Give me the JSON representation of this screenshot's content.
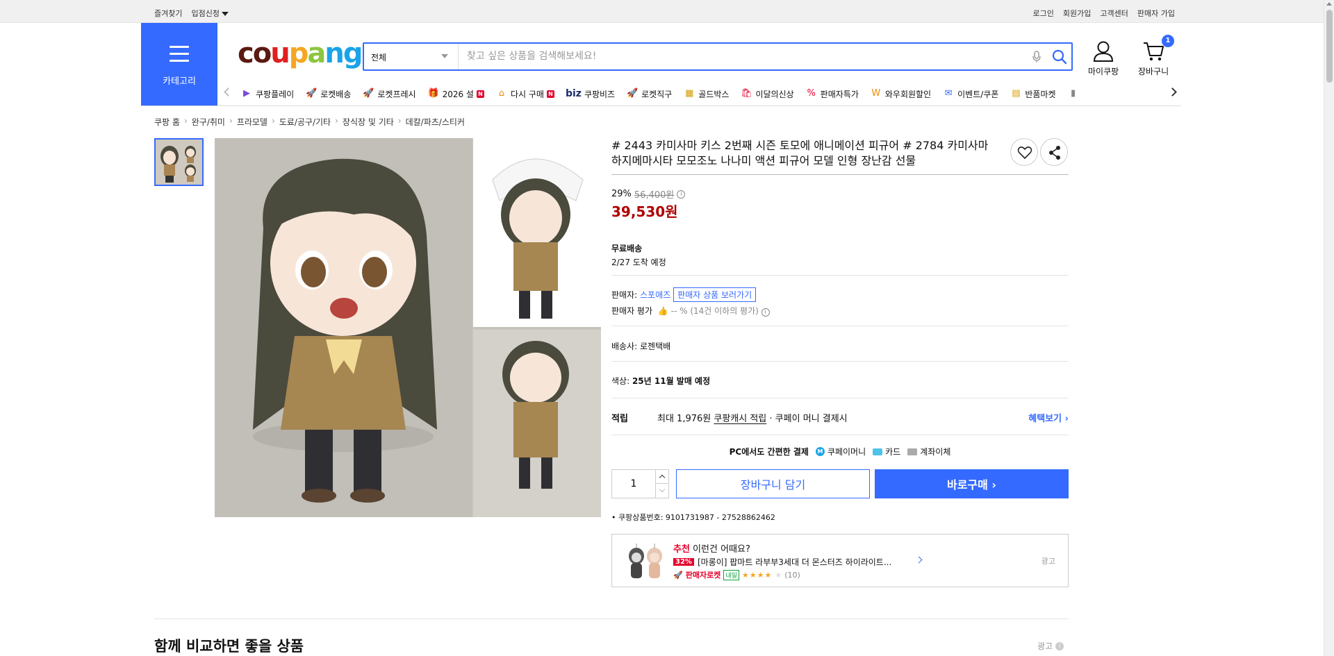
{
  "topbar": {
    "left": [
      "즐겨찾기",
      "입점신청"
    ],
    "right": [
      "로그인",
      "회원가입",
      "고객센터",
      "판매자 가입"
    ]
  },
  "header": {
    "category_label": "카테고리",
    "logo": [
      "c",
      "o",
      "u",
      "p",
      "a",
      "n",
      "g"
    ],
    "logo_colors": [
      "#5b1a0f",
      "#5b1a0f",
      "#e02020",
      "#f5a623",
      "#8cc63f",
      "#1aa3e8",
      "#1aa3e8"
    ],
    "search": {
      "category": "전체",
      "placeholder": "찾고 싶은 상품을 검색해보세요!",
      "value": ""
    },
    "mycoupang_label": "마이쿠팡",
    "cart_label": "장바구니",
    "cart_count": "1"
  },
  "nav": [
    {
      "icon": "▶",
      "label": "쿠팡플레이",
      "color": "#7b4cd8",
      "new": false
    },
    {
      "icon": "🚀",
      "label": "로켓배송",
      "color": "#346aff",
      "new": false
    },
    {
      "icon": "🚀",
      "label": "로켓프레시",
      "color": "#2fb36b",
      "new": false
    },
    {
      "icon": "🎁",
      "label": "2026 설",
      "color": "#e4002b",
      "new": true
    },
    {
      "icon": "⌂",
      "label": "다시 구매",
      "color": "#f08a00",
      "new": true
    },
    {
      "icon": "biz",
      "label": "쿠팡비즈",
      "color": "#1b2b6b",
      "new": false
    },
    {
      "icon": "🚀",
      "label": "로켓직구",
      "color": "#9b3cd8",
      "new": false
    },
    {
      "icon": "▦",
      "label": "골드박스",
      "color": "#d49b00",
      "new": false
    },
    {
      "icon": "🛍",
      "label": "이달의신상",
      "color": "#e4002b",
      "new": false
    },
    {
      "icon": "%",
      "label": "판매자특가",
      "color": "#e4002b",
      "new": false
    },
    {
      "icon": "W",
      "label": "와우회원할인",
      "color": "#f08a00",
      "new": false
    },
    {
      "icon": "✉",
      "label": "이벤트/쿠폰",
      "color": "#346aff",
      "new": false
    },
    {
      "icon": "▤",
      "label": "반품마켓",
      "color": "#d49b00",
      "new": false
    },
    {
      "icon": "▮",
      "label": "",
      "color": "#888",
      "new": false
    }
  ],
  "breadcrumb": [
    "쿠팡 홈",
    "완구/취미",
    "프라모델",
    "도료/공구/기타",
    "장식장 및 기타",
    "데칼/파츠/스티커"
  ],
  "product": {
    "title": "# 2443 카미사마 키스 2번째 시즌 토모에 애니메이션 피규어 # 2784 카미사마 하지메마시타 모모조노 나나미 액션 피규어 모델 인형 장난감 선물",
    "discount": "29%",
    "original_price": "56,400원",
    "price": "39,530원",
    "shipping_title": "무료배송",
    "arrival": "2/27 도착 예정",
    "seller_label": "판매자:",
    "seller_name": "스포애즈",
    "seller_button": "판매자 상품 보러가기",
    "seller_rating_label": "판매자 평가",
    "seller_rating_value": "-- % (14건 이하의 평가)",
    "carrier_label": "배송사:",
    "carrier": "로젠택배",
    "color_label": "색상:",
    "color_value": "25년 11월 발매 예정",
    "reward_key": "적립",
    "reward_prefix": "최대 1,976원",
    "reward_link": "쿠팡캐시 적립",
    "reward_suffix": "· 쿠페이 머니 결제시",
    "reward_more": "혜택보기 ›",
    "pc_pay_label": "PC에서도 간편한 결제",
    "pay_methods": [
      "쿠페이머니",
      "카드",
      "계좌이체"
    ],
    "quantity": "1",
    "cart_button": "장바구니 담기",
    "buy_button": "바로구매 ›",
    "product_id": "쿠팡상품번호: 9101731987 - 27528862462"
  },
  "recommend": {
    "red": "추천",
    "title": " 이런건 어때요?",
    "pct": "32%",
    "name": "[마롱이] 팝마트 라부부3세대 더 몬스터즈 하이라이트...",
    "seller_tag": "판매자로켓",
    "tomorrow": "내일",
    "stars": "★★★★",
    "star_empty": "★",
    "reviews": "(10)",
    "ad": "광고"
  },
  "section": {
    "title": "함께 비교하면 좋을 상품",
    "ad": "광고"
  }
}
